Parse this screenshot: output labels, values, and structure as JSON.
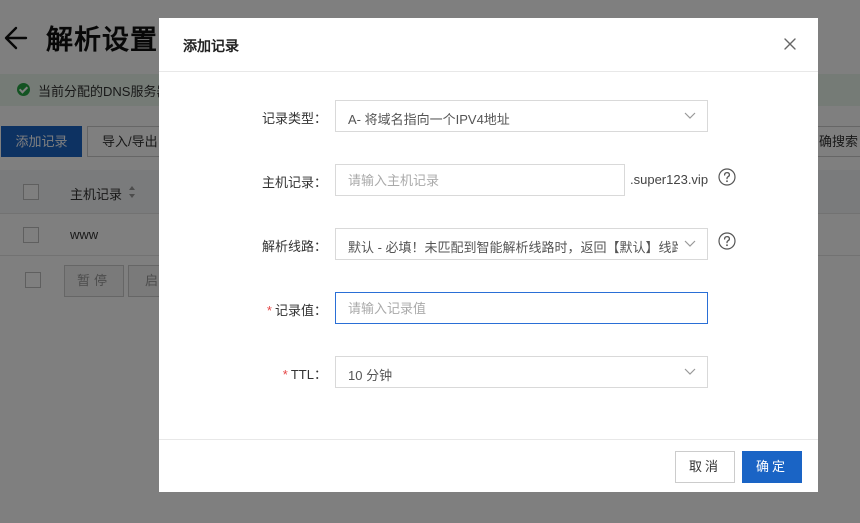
{
  "background": {
    "page_title": "解析设置",
    "dns_banner": "当前分配的DNS服务器",
    "buttons": {
      "add_record": "添加记录",
      "import_export": "导入/导出",
      "search": "确搜索"
    },
    "table": {
      "header_host": "主机记录",
      "rows": [
        {
          "host": "www"
        }
      ]
    },
    "footer": {
      "pause": "暂停",
      "enable": "启"
    }
  },
  "modal": {
    "title": "添加记录",
    "fields": {
      "record_type": {
        "label": "记录类型",
        "value": "A- 将域名指向一个IPV4地址"
      },
      "host_record": {
        "label": "主机记录",
        "placeholder": "请输入主机记录",
        "value": "",
        "suffix": ".super123.vip"
      },
      "line": {
        "label": "解析线路",
        "value": "默认 - 必填！未匹配到智能解析线路时，返回【默认】线路..."
      },
      "record_value": {
        "label": "记录值",
        "placeholder": "请输入记录值",
        "value": ""
      },
      "ttl": {
        "label": "TTL",
        "value": "10 分钟"
      }
    },
    "buttons": {
      "cancel": "取消",
      "confirm": "确定"
    }
  },
  "colors": {
    "primary": "#1a64c5",
    "required": "#e54545",
    "success": "#26a644",
    "focus_border": "#2a6fd6"
  }
}
